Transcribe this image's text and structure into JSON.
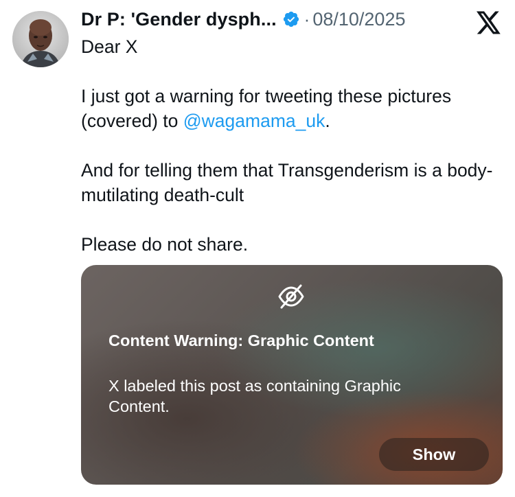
{
  "post": {
    "author_name": "Dr P: 'Gender dysph...",
    "verified_icon": "verified-badge-icon",
    "separator": "·",
    "date": "08/10/2025",
    "platform_logo": "x-logo-icon",
    "body": {
      "line1": "Dear X",
      "para2_text": "I just got a warning for tweeting these pictures (covered) to ",
      "para2_mention": "@wagamama_uk",
      "para2_end": ".",
      "para3": "And for telling them that Transgenderism is a body-mutilating death-cult",
      "para4": "Please do not share."
    },
    "media_warning": {
      "icon": "eye-off-icon",
      "title": "Content Warning: Graphic Content",
      "description": "X labeled this post as containing Graphic Content.",
      "show_label": "Show"
    }
  },
  "colors": {
    "text": "#0f1419",
    "secondary": "#536471",
    "link": "#1d9bf0",
    "verified": "#1d9bf0"
  }
}
